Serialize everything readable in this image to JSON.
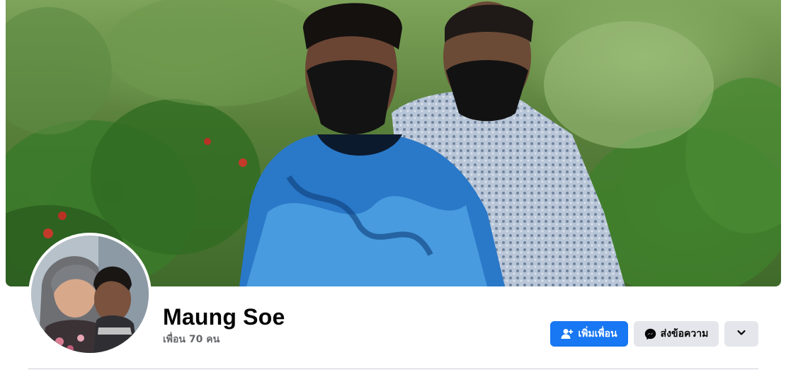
{
  "profile": {
    "name": "Maung Soe",
    "friends_text": "เพื่อน 70 คน"
  },
  "actions": {
    "add_friend_label": "เพิ่มเพื่อน",
    "message_label": "ส่งข้อความ",
    "more_icon": "chevron-down-icon",
    "add_friend_icon": "person-add-icon",
    "message_icon": "messenger-icon"
  },
  "colors": {
    "primary": "#1877f2",
    "secondary_button": "#e4e6eb",
    "name_text": "#050505",
    "meta_text": "#65676b",
    "divider": "#ced0d4"
  }
}
